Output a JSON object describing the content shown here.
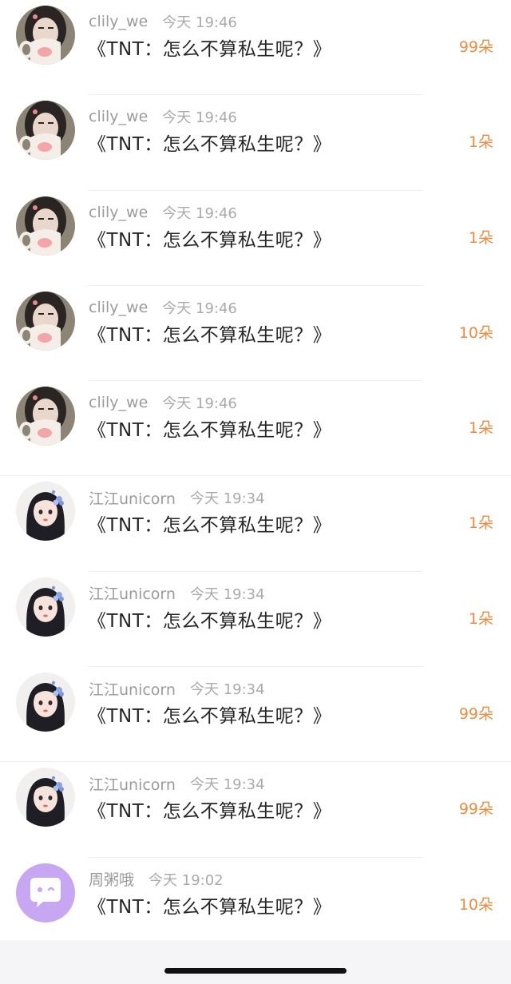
{
  "gift_list": [
    {
      "user": "clily_we",
      "time": "今天 19:46",
      "title": "《TNT：怎么不算私生呢？》",
      "count": "99朵",
      "avatar": "girl-with-mug-avatar"
    },
    {
      "user": "clily_we",
      "time": "今天 19:46",
      "title": "《TNT：怎么不算私生呢？》",
      "count": "1朵",
      "avatar": "girl-with-mug-avatar"
    },
    {
      "user": "clily_we",
      "time": "今天 19:46",
      "title": "《TNT：怎么不算私生呢？》",
      "count": "1朵",
      "avatar": "girl-with-mug-avatar"
    },
    {
      "user": "clily_we",
      "time": "今天 19:46",
      "title": "《TNT：怎么不算私生呢？》",
      "count": "10朵",
      "avatar": "girl-with-mug-avatar"
    },
    {
      "user": "clily_we",
      "time": "今天 19:46",
      "title": "《TNT：怎么不算私生呢？》",
      "count": "1朵",
      "avatar": "girl-with-mug-avatar"
    },
    {
      "user": "江江unicorn",
      "time": "今天 19:34",
      "title": "《TNT：怎么不算私生呢？》",
      "count": "1朵",
      "avatar": "anime-girl-avatar"
    },
    {
      "user": "江江unicorn",
      "time": "今天 19:34",
      "title": "《TNT：怎么不算私生呢？》",
      "count": "1朵",
      "avatar": "anime-girl-avatar"
    },
    {
      "user": "江江unicorn",
      "time": "今天 19:34",
      "title": "《TNT：怎么不算私生呢？》",
      "count": "99朵",
      "avatar": "anime-girl-avatar"
    },
    {
      "user": "江江unicorn",
      "time": "今天 19:34",
      "title": "《TNT：怎么不算私生呢？》",
      "count": "99朵",
      "avatar": "anime-girl-avatar"
    },
    {
      "user": "周粥哦",
      "time": "今天 19:02",
      "title": "《TNT：怎么不算私生呢？》",
      "count": "10朵",
      "avatar": "chat-bubble-avatar"
    }
  ],
  "colors": {
    "count": "#f08a3c",
    "username": "#9b9b9b",
    "title": "#262626",
    "chat_avatar_bg": "#c7a6f2"
  }
}
